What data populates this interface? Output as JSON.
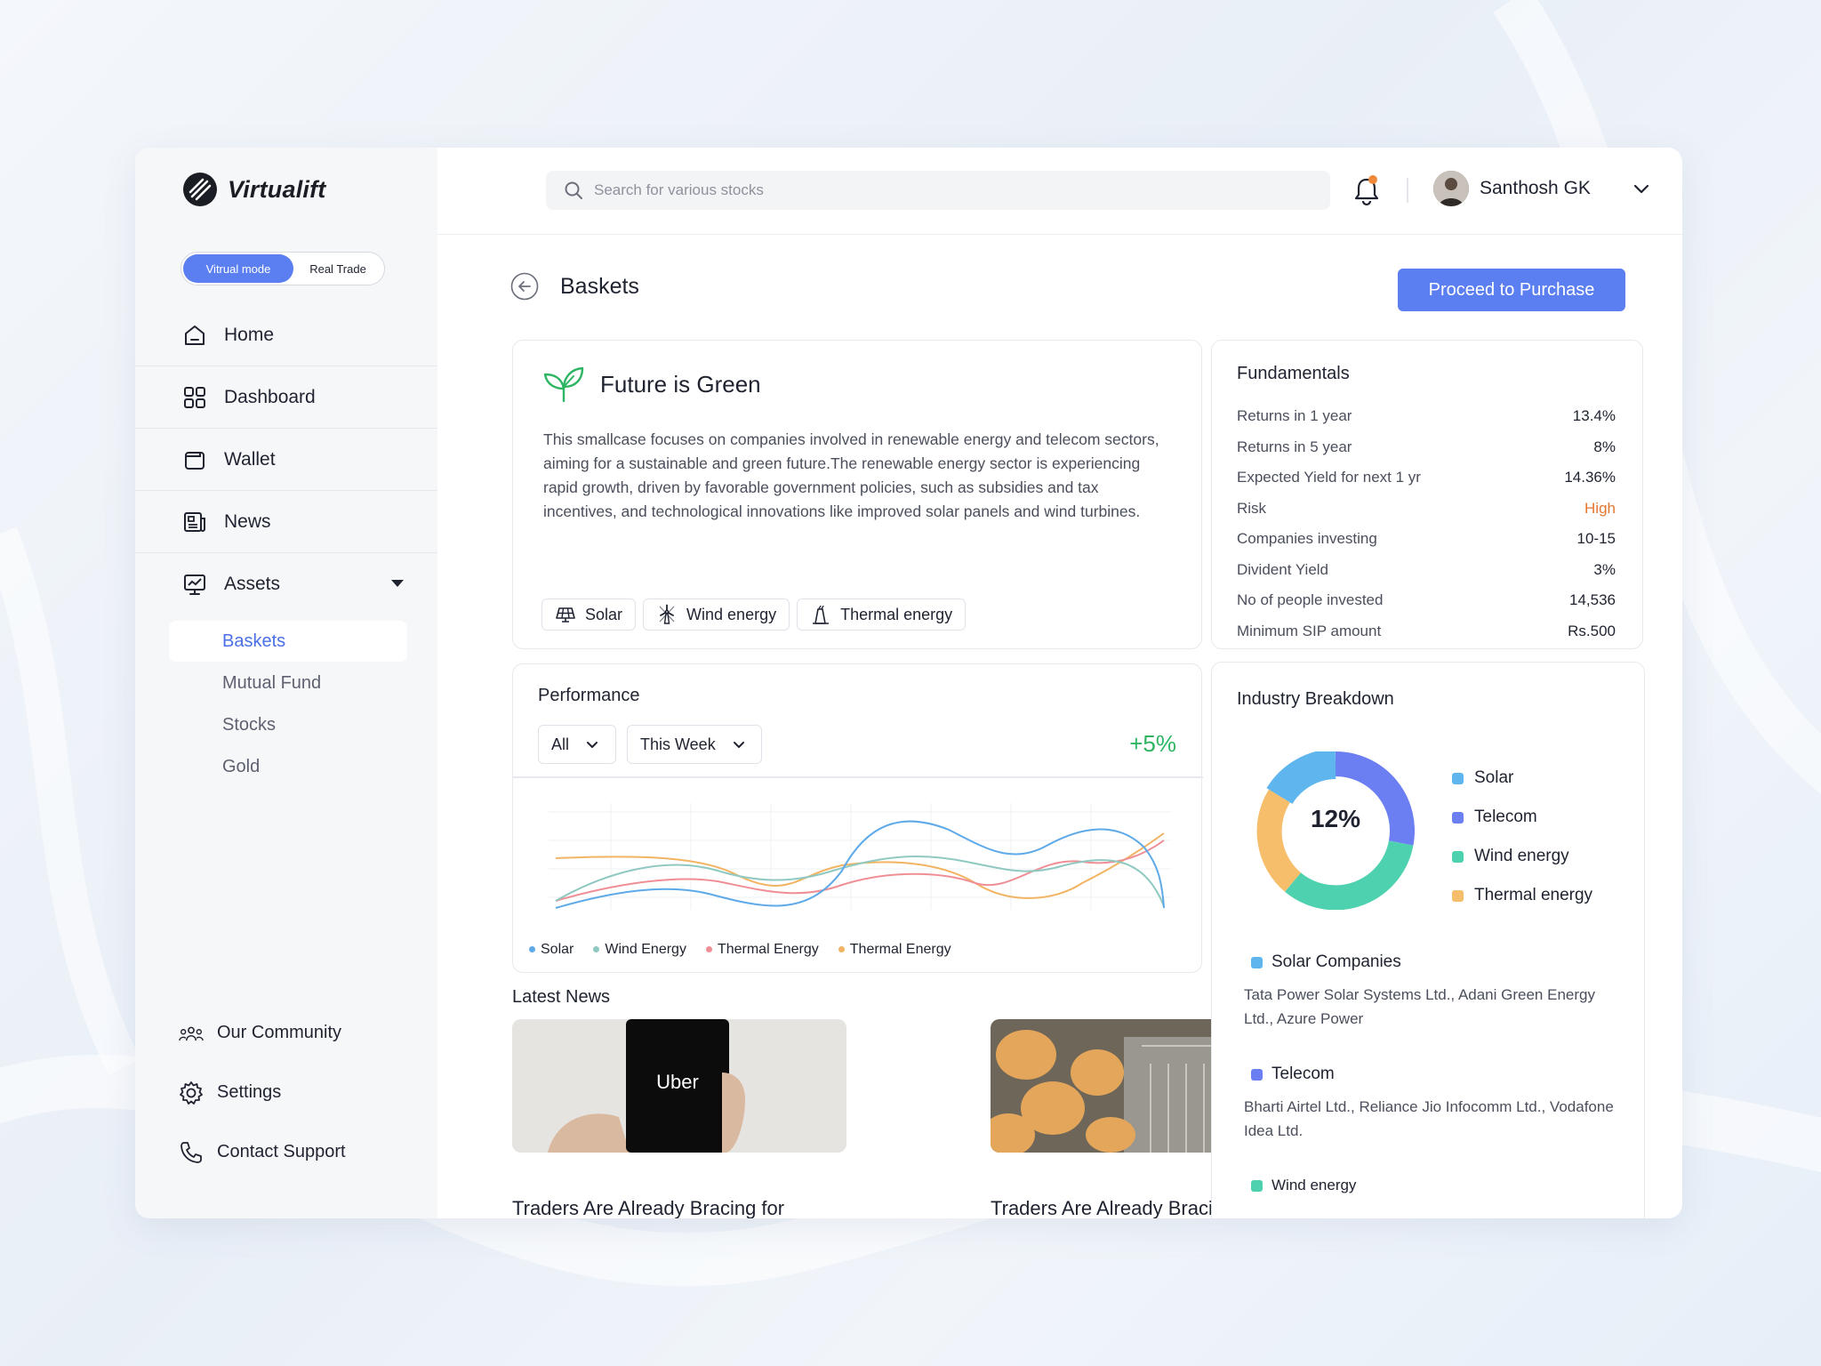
{
  "brand": {
    "name": "Virtualift"
  },
  "mode_toggle": {
    "active": "Vitrual mode",
    "inactive": "Real Trade"
  },
  "nav": {
    "home": "Home",
    "dashboard": "Dashboard",
    "wallet": "Wallet",
    "news": "News",
    "assets": "Assets"
  },
  "subnav": {
    "baskets": "Baskets",
    "mutual_fund": "Mutual Fund",
    "stocks": "Stocks",
    "gold": "Gold"
  },
  "bottom_nav": {
    "community": "Our Community",
    "settings": "Settings",
    "support": "Contact Support"
  },
  "search": {
    "placeholder": "Search for various stocks"
  },
  "user": {
    "name": "Santhosh GK"
  },
  "page": {
    "title": "Baskets",
    "cta": "Proceed to Purchase"
  },
  "basket": {
    "title": "Future is Green",
    "description": "This smallcase focuses on companies involved in renewable energy and telecom sectors, aiming for a sustainable and green future.The renewable energy sector is experiencing rapid growth, driven by favorable government policies, such as subsidies and tax incentives, and technological innovations like improved solar panels and wind turbines.",
    "tags": [
      "Solar",
      "Wind energy",
      "Thermal energy"
    ]
  },
  "fundamentals": {
    "title": "Fundamentals",
    "rows": [
      {
        "label": "Returns in 1 year",
        "value": "13.4%"
      },
      {
        "label": "Returns in 5 year",
        "value": "8%"
      },
      {
        "label": "Expected Yield for next 1 yr",
        "value": "14.36%"
      },
      {
        "label": "Risk",
        "value": "High"
      },
      {
        "label": "Companies investing",
        "value": "10-15"
      },
      {
        "label": "Divident Yield",
        "value": "3%"
      },
      {
        "label": "No of people invested",
        "value": "14,536"
      },
      {
        "label": "Minimum SIP amount",
        "value": "Rs.500"
      }
    ],
    "risk_color": "#e2762e"
  },
  "performance": {
    "title": "Performance",
    "filter_type": "All",
    "filter_period": "This Week",
    "change": "+5%",
    "legend": [
      {
        "name": "Solar",
        "color": "#5ea9e8"
      },
      {
        "name": "Wind Energy",
        "color": "#8fc9c1"
      },
      {
        "name": "Thermal Energy",
        "color": "#ef8f95"
      },
      {
        "name": "Thermal Energy",
        "color": "#f2b463"
      }
    ]
  },
  "news": {
    "title": "Latest News",
    "items": [
      {
        "headline": "Traders Are Already Bracing for",
        "image_text": "Uber"
      },
      {
        "headline": "Traders Are Already Bracing for"
      }
    ]
  },
  "industry": {
    "title": "Industry Breakdown",
    "center_label": "12%",
    "legend": [
      {
        "name": "Solar",
        "color": "#5fb6ee"
      },
      {
        "name": "Telecom",
        "color": "#6c7ff2"
      },
      {
        "name": "Wind energy",
        "color": "#4dd1ae"
      },
      {
        "name": "Thermal energy",
        "color": "#f6bd6a"
      }
    ],
    "groups": [
      {
        "name": "Solar Companies",
        "color": "#5fb6ee",
        "companies": "Tata Power Solar Systems Ltd., Adani Green Energy Ltd., Azure Power"
      },
      {
        "name": "Telecom",
        "color": "#6c7ff2",
        "companies": "Bharti Airtel Ltd., Reliance Jio Infocomm Ltd., Vodafone Idea Ltd."
      },
      {
        "name": "Wind energy",
        "color": "#4dd1ae",
        "companies": ""
      }
    ]
  }
}
